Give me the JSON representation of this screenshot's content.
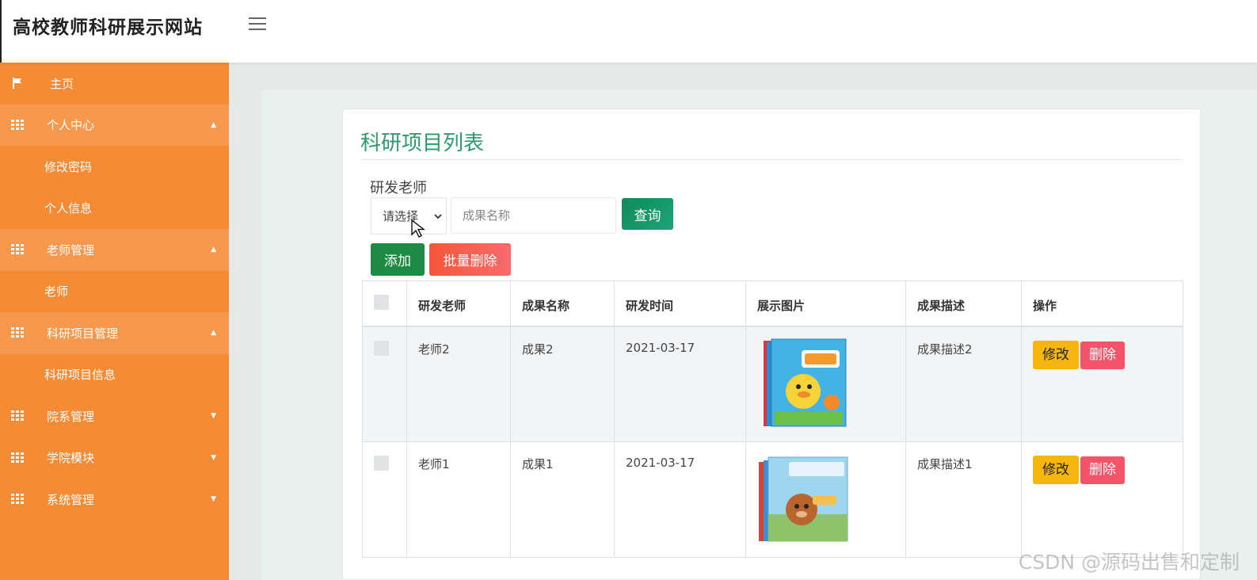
{
  "header": {
    "site_title": "高校教师科研展示网站"
  },
  "sidebar": {
    "items": [
      {
        "label": "主页",
        "icon": "flag-icon"
      },
      {
        "label": "个人中心",
        "icon": "grid-icon",
        "caret": "up"
      },
      {
        "label": "修改密码"
      },
      {
        "label": "个人信息"
      },
      {
        "label": "老师管理",
        "icon": "grid-icon",
        "caret": "up"
      },
      {
        "label": "老师"
      },
      {
        "label": "科研项目管理",
        "icon": "grid-icon",
        "caret": "up"
      },
      {
        "label": "科研项目信息"
      },
      {
        "label": "院系管理",
        "icon": "grid-icon",
        "caret": "down"
      },
      {
        "label": "学院模块",
        "icon": "grid-icon",
        "caret": "down"
      },
      {
        "label": "系统管理",
        "icon": "grid-icon",
        "caret": "down"
      }
    ]
  },
  "page": {
    "title": "科研项目列表"
  },
  "filter": {
    "teacher_label": "研发老师",
    "select_value": "请选择",
    "name_placeholder": "成果名称",
    "query_label": "查询"
  },
  "actions": {
    "add_label": "添加",
    "batch_delete_label": "批量删除"
  },
  "table": {
    "columns": [
      "研发老师",
      "成果名称",
      "研发时间",
      "展示图片",
      "成果描述",
      "操作"
    ],
    "rows": [
      {
        "teacher": "老师2",
        "name": "成果2",
        "date": "2021-03-17",
        "image": "book-cover-1",
        "desc": "成果描述2",
        "edit": "修改",
        "delete": "删除"
      },
      {
        "teacher": "老师1",
        "name": "成果1",
        "date": "2021-03-17",
        "image": "book-cover-2",
        "desc": "成果描述1",
        "edit": "修改",
        "delete": "删除"
      }
    ]
  },
  "colors": {
    "sidebar": "#f58b34",
    "accent_green": "#2e9b6e",
    "edit": "#f7b60d",
    "delete": "#f4546a"
  },
  "watermark": "CSDN @源码出售和定制"
}
